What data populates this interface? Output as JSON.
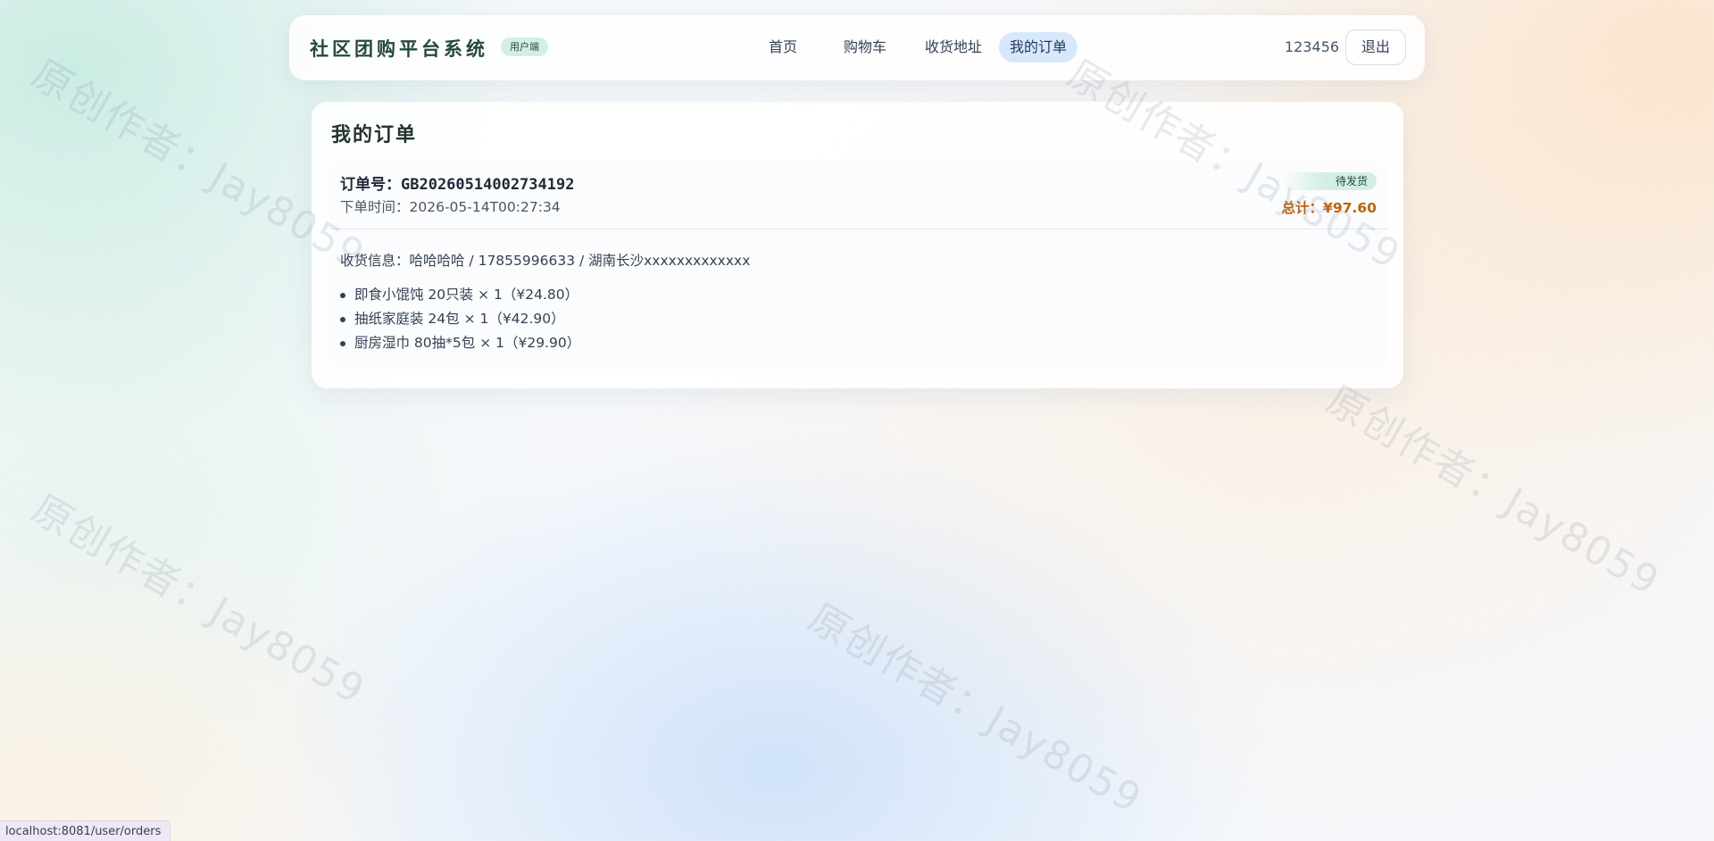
{
  "header": {
    "brand": "社区团购平台系统",
    "badge": "用户端",
    "nav": [
      "首页",
      "购物车",
      "收货地址",
      "我的订单"
    ],
    "active_nav": "我的订单",
    "username": "123456",
    "logout_label": "退出"
  },
  "main": {
    "title": "我的订单",
    "orders": [
      {
        "order_no": "订单号：GB20260514002734192",
        "time": "下单时间：2026-05-14T00:27:34",
        "status": "待发货",
        "total": "总计：¥97.60",
        "shipping": "收货信息：哈哈哈哈 / 17855996633 / 湖南长沙xxxxxxxxxxxxx",
        "items": [
          "即食小馄饨 20只装 × 1（¥24.80）",
          "抽纸家庭装 24包 × 1（¥42.90）",
          "厨房湿巾 80抽*5包 × 1（¥29.90）"
        ]
      }
    ]
  },
  "watermark": "原创作者：Jay8059",
  "status_url": "localhost:8081/user/orders"
}
